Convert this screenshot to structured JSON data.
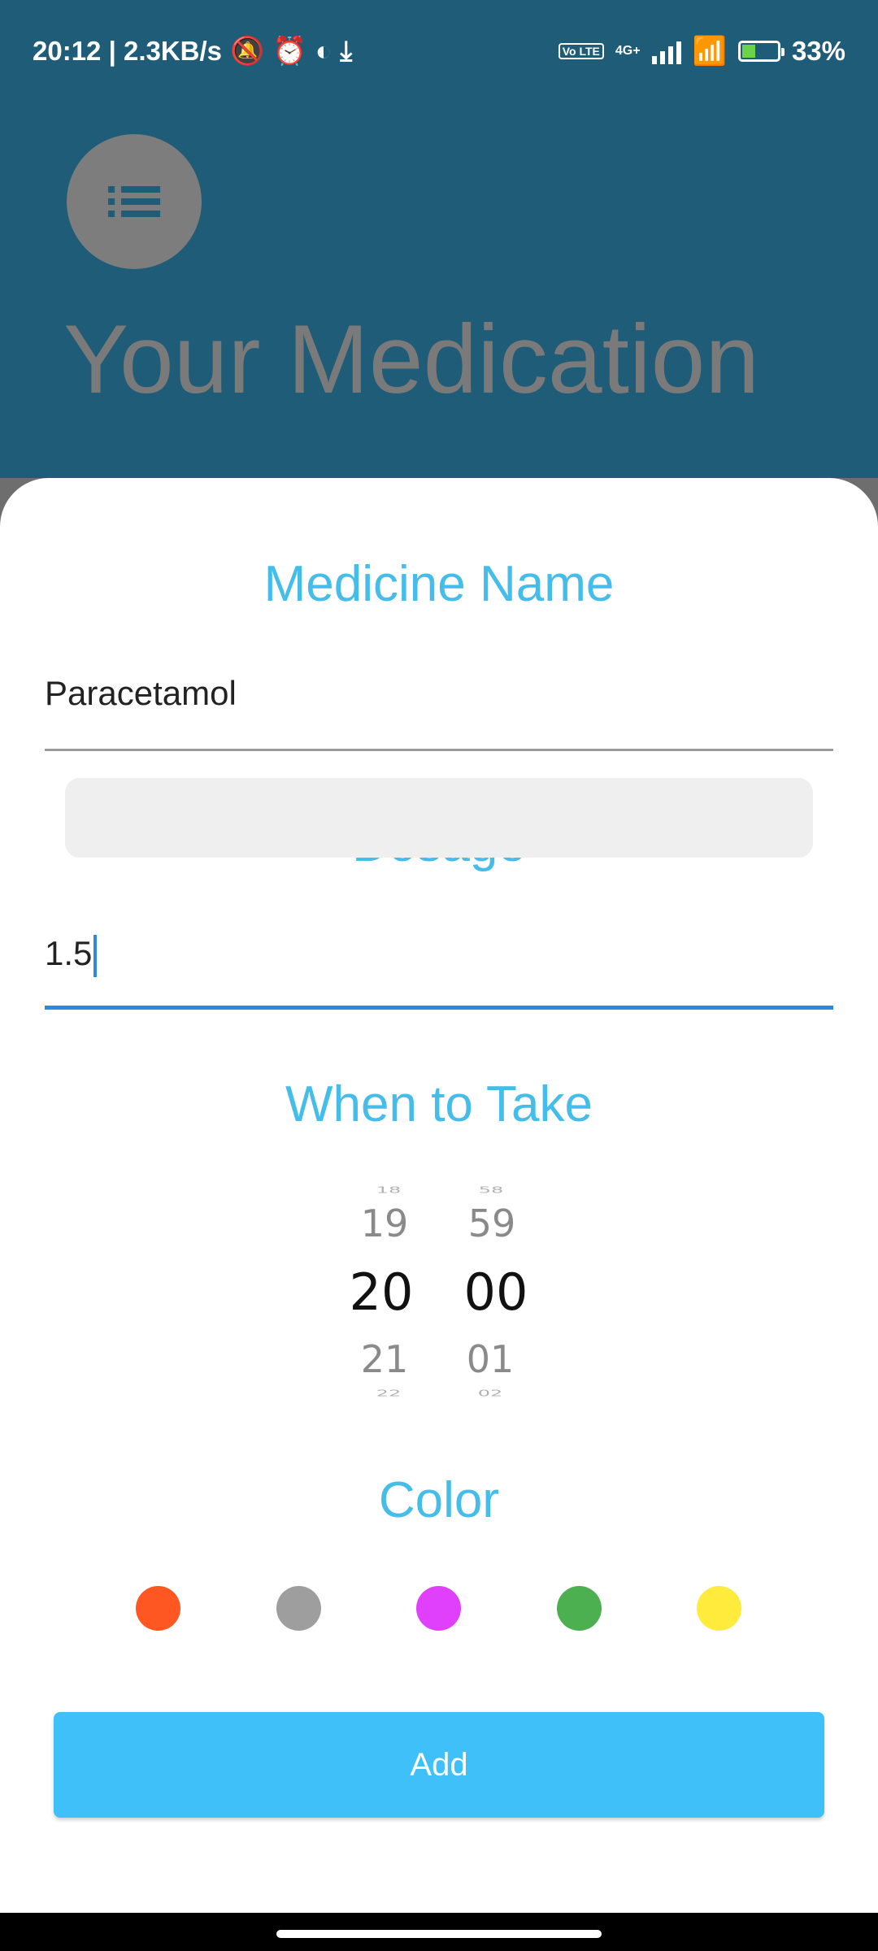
{
  "status_bar": {
    "time_speed": "20:12 | 2.3KB/s",
    "lte": "Vo LTE",
    "network": "4G+",
    "battery": "33%"
  },
  "background": {
    "title": "Your Medication"
  },
  "form": {
    "medicine_label": "Medicine Name",
    "medicine_value": "Paracetamol",
    "dosage_label": "Dosage",
    "dosage_value": "1.5",
    "when_label": "When to Take",
    "hours": [
      "18",
      "19",
      "20",
      "21",
      "22"
    ],
    "minutes": [
      "58",
      "59",
      "00",
      "01",
      "02"
    ],
    "color_label": "Color",
    "colors": [
      "#ff5722",
      "#9e9e9e",
      "#e040fb",
      "#4caf50",
      "#ffeb3b"
    ],
    "add_label": "Add"
  }
}
